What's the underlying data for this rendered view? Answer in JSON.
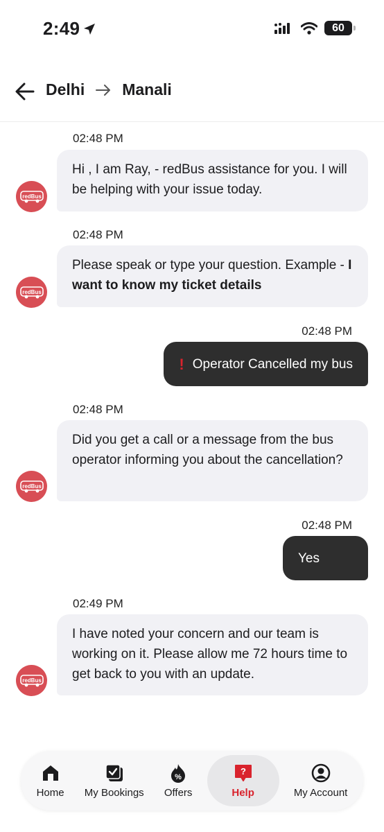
{
  "status_bar": {
    "time": "2:49",
    "battery": "60"
  },
  "header": {
    "origin": "Delhi",
    "destination": "Manali"
  },
  "messages": [
    {
      "time": "02:48 PM",
      "text": "Hi , I am Ray, - redBus assistance for you. I will be helping with your issue today."
    },
    {
      "time": "02:48 PM",
      "text_plain": "Please speak or type your question. Example - ",
      "text_bold": "I want to know my ticket details"
    },
    {
      "time": "02:48 PM",
      "text": "Operator Cancelled my bus"
    },
    {
      "time": "02:48 PM",
      "text": "Did you get a call or a message from the bus operator informing you about the cancellation?"
    },
    {
      "time": "02:48 PM",
      "text": "Yes"
    },
    {
      "time": "02:49 PM",
      "text": "I have noted your concern and our team is working on it. Please allow me 72 hours time to get back to you with an update."
    }
  ],
  "avatar_text": "redBus",
  "nav": [
    {
      "label": "Home",
      "icon": "home-icon"
    },
    {
      "label": "My Bookings",
      "icon": "bookings-icon"
    },
    {
      "label": "Offers",
      "icon": "offers-icon"
    },
    {
      "label": "Help",
      "icon": "help-icon",
      "active": true
    },
    {
      "label": "My Account",
      "icon": "account-icon"
    }
  ],
  "colors": {
    "brand_red": "#d84e55",
    "accent_red": "#d9232d",
    "user_bubble": "#2e2e2e",
    "bot_bubble": "#f1f1f5"
  }
}
